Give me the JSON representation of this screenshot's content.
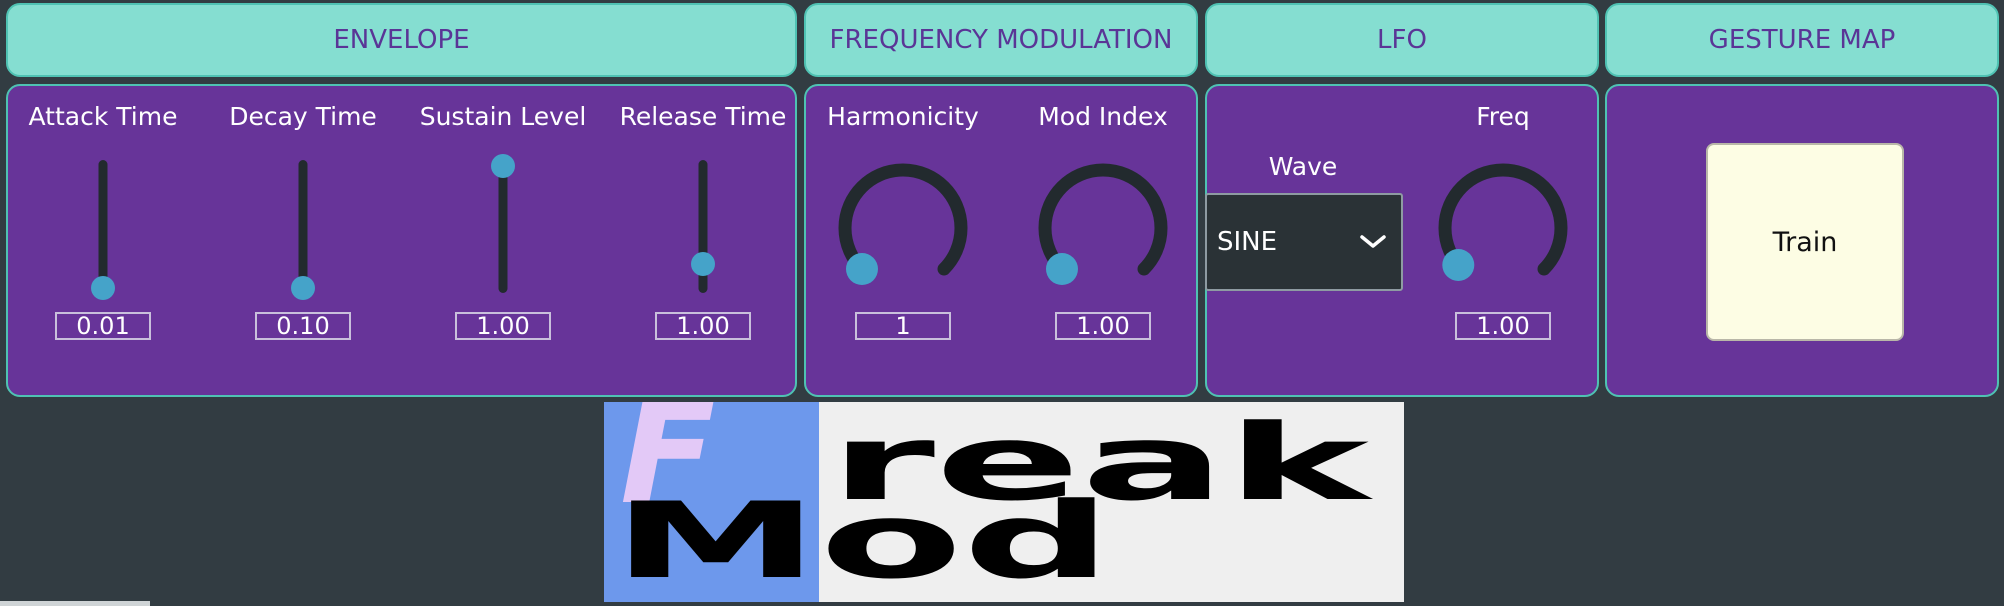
{
  "sections": {
    "envelope": "ENVELOPE",
    "fm": "FREQUENCY MODULATION",
    "lfo": "LFO",
    "gesture": "GESTURE MAP"
  },
  "envelope": {
    "attack": {
      "label": "Attack Time",
      "value": "0.01",
      "level": 0.0
    },
    "decay": {
      "label": "Decay Time",
      "value": "0.10",
      "level": 0.0
    },
    "sustain": {
      "label": "Sustain Level",
      "value": "1.00",
      "level": 1.0
    },
    "release": {
      "label": "Release Time",
      "value": "1.00",
      "level": 0.2
    }
  },
  "fm": {
    "harmonicity": {
      "label": "Harmonicity",
      "value": "1",
      "level": 0.0
    },
    "mod_index": {
      "label": "Mod Index",
      "value": "1.00",
      "level": 0.0
    }
  },
  "lfo": {
    "wave_label": "Wave",
    "wave_value": "SINE",
    "freq": {
      "label": "Freq",
      "value": "1.00",
      "level": 0.02
    }
  },
  "gesture": {
    "train_label": "Train"
  },
  "logo": {
    "line1": "reak",
    "line2": "Mod",
    "letter": "F"
  },
  "colors": {
    "background": "#323c42",
    "header": "#85ded1",
    "panel": "#673499",
    "accent": "#45a3c9",
    "track": "#222a2e"
  },
  "icons": {
    "dropdown": "chevron-down-icon"
  }
}
